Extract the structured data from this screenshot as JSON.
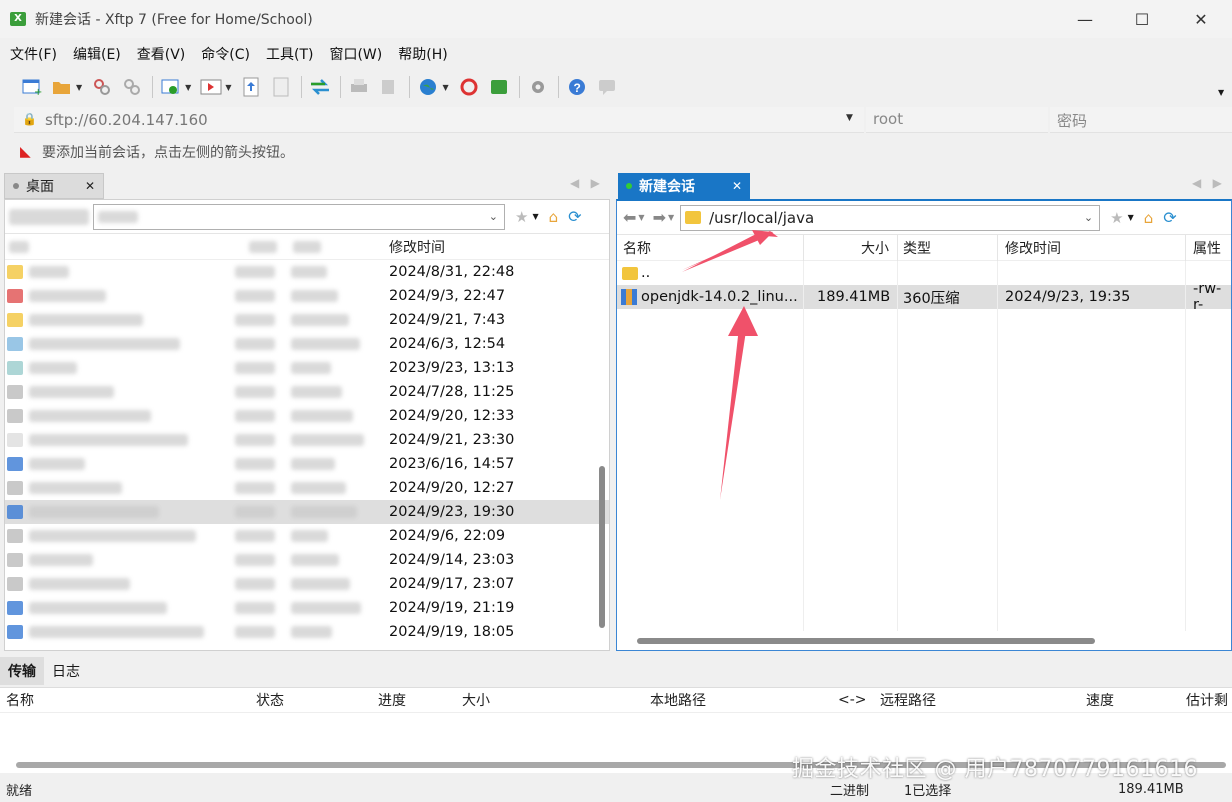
{
  "window": {
    "title": "新建会话 - Xftp 7 (Free for Home/School)",
    "minimize": "—",
    "maximize": "☐",
    "close": "✕"
  },
  "menu": [
    "文件(F)",
    "编辑(E)",
    "查看(V)",
    "命令(C)",
    "工具(T)",
    "窗口(W)",
    "帮助(H)"
  ],
  "address": {
    "url": "sftp://60.204.147.160",
    "user_placeholder": "root",
    "password_placeholder": "密码"
  },
  "hint": "要添加当前会话，点击左侧的箭头按钮。",
  "left_pane": {
    "tab_label": "桌面",
    "column_modified": "修改时间",
    "dates": [
      "2024/8/31, 22:48",
      "2024/9/3, 22:47",
      "2024/9/21, 7:43",
      "2024/6/3, 12:54",
      "2023/9/23, 13:13",
      "2024/7/28, 11:25",
      "2024/9/20, 12:33",
      "2024/9/21, 23:30",
      "2023/6/16, 14:57",
      "2024/9/20, 12:27",
      "2024/9/23, 19:30",
      "2024/9/6, 22:09",
      "2024/9/14, 23:03",
      "2024/9/17, 23:07",
      "2024/9/19, 21:19",
      "2024/9/19, 18:05"
    ]
  },
  "right_pane": {
    "tab_label": "新建会话",
    "path": "/usr/local/java",
    "columns": {
      "name": "名称",
      "size": "大小",
      "type": "类型",
      "modified": "修改时间",
      "attr": "属性"
    },
    "rows": [
      {
        "name": "..",
        "size": "",
        "type": "",
        "modified": "",
        "attr": ""
      },
      {
        "name": "openjdk-14.0.2_linu...",
        "size": "189.41MB",
        "type": "360压缩",
        "modified": "2024/9/23, 19:35",
        "attr": "-rw-r-"
      }
    ]
  },
  "bottom": {
    "tabs": [
      "传输",
      "日志"
    ],
    "columns": [
      "名称",
      "状态",
      "进度",
      "大小",
      "本地路径",
      "<->",
      "远程路径",
      "速度",
      "估计剩"
    ]
  },
  "status": {
    "ready": "就绪",
    "mode": "二进制",
    "selected": "1已选择",
    "size": "189.41MB"
  },
  "watermark": "掘金技术社区 @ 用户7870779161616"
}
